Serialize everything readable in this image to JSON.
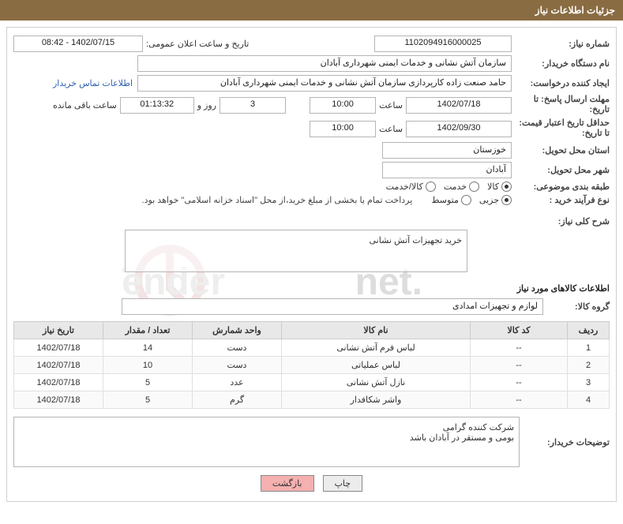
{
  "header": {
    "title": "جزئیات اطلاعات نیاز"
  },
  "fields": {
    "need_no_label": "شماره نیاز:",
    "need_no": "1102094916000025",
    "announce_label": "تاریخ و ساعت اعلان عمومی:",
    "announce_value": "1402/07/15 - 08:42",
    "buyer_org_label": "نام دستگاه خریدار:",
    "buyer_org": "سازمان آتش نشانی و خدمات ایمنی شهرداری آبادان",
    "requester_label": "ایجاد کننده درخواست:",
    "requester": "حامد صنعت زاده کارپردازی سازمان آتش نشانی و خدمات ایمنی شهرداری آبادان",
    "contact_link": "اطلاعات تماس خریدار",
    "deadline_label": "مهلت ارسال پاسخ: تا تاریخ:",
    "deadline_date": "1402/07/18",
    "time_label": "ساعت",
    "deadline_time": "10:00",
    "days_and": "روز و",
    "days_remaining": "3",
    "countdown": "01:13:32",
    "remaining_label": "ساعت باقی مانده",
    "validity_label": "حداقل تاریخ اعتبار قیمت: تا تاریخ:",
    "validity_date": "1402/09/30",
    "validity_time": "10:00",
    "province_label": "استان محل تحویل:",
    "province": "خوزستان",
    "city_label": "شهر محل تحویل:",
    "city": "آبادان",
    "category_label": "طبقه بندی موضوعی:",
    "cat_goods": "کالا",
    "cat_service": "خدمت",
    "cat_both": "کالا/خدمت",
    "process_label": "نوع فرآیند خرید :",
    "proc_partial": "جزیی",
    "proc_medium": "متوسط",
    "payment_note": "پرداخت تمام یا بخشی از مبلغ خرید،از محل \"اسناد خزانه اسلامی\" خواهد بود.",
    "overall_label": "شرح کلی نیاز:",
    "overall_desc": "خرید تجهیزات آتش نشانی",
    "goods_section": "اطلاعات کالاهای مورد نیاز",
    "group_label": "گروه کالا:",
    "group_value": "لوازم و تجهیزات امدادی",
    "buyer_notes_label": "توضیحات خریدار:",
    "buyer_notes_line1": "شرکت کننده گرامی",
    "buyer_notes_line2": "بومی و مستقر در آبادان باشد"
  },
  "table": {
    "headers": {
      "row": "ردیف",
      "code": "کد کالا",
      "name": "نام کالا",
      "unit": "واحد شمارش",
      "qty": "تعداد / مقدار",
      "need_date": "تاریخ نیاز"
    },
    "rows": [
      {
        "row": "1",
        "code": "--",
        "name": "لباس فرم آتش نشانی",
        "unit": "دست",
        "qty": "14",
        "need_date": "1402/07/18"
      },
      {
        "row": "2",
        "code": "--",
        "name": "لباس عملیاتی",
        "unit": "دست",
        "qty": "10",
        "need_date": "1402/07/18"
      },
      {
        "row": "3",
        "code": "--",
        "name": "نازل آتش نشانی",
        "unit": "عدد",
        "qty": "5",
        "need_date": "1402/07/18"
      },
      {
        "row": "4",
        "code": "--",
        "name": "واشر شکافدار",
        "unit": "گرم",
        "qty": "5",
        "need_date": "1402/07/18"
      }
    ]
  },
  "footer": {
    "print": "چاپ",
    "back": "بازگشت"
  }
}
